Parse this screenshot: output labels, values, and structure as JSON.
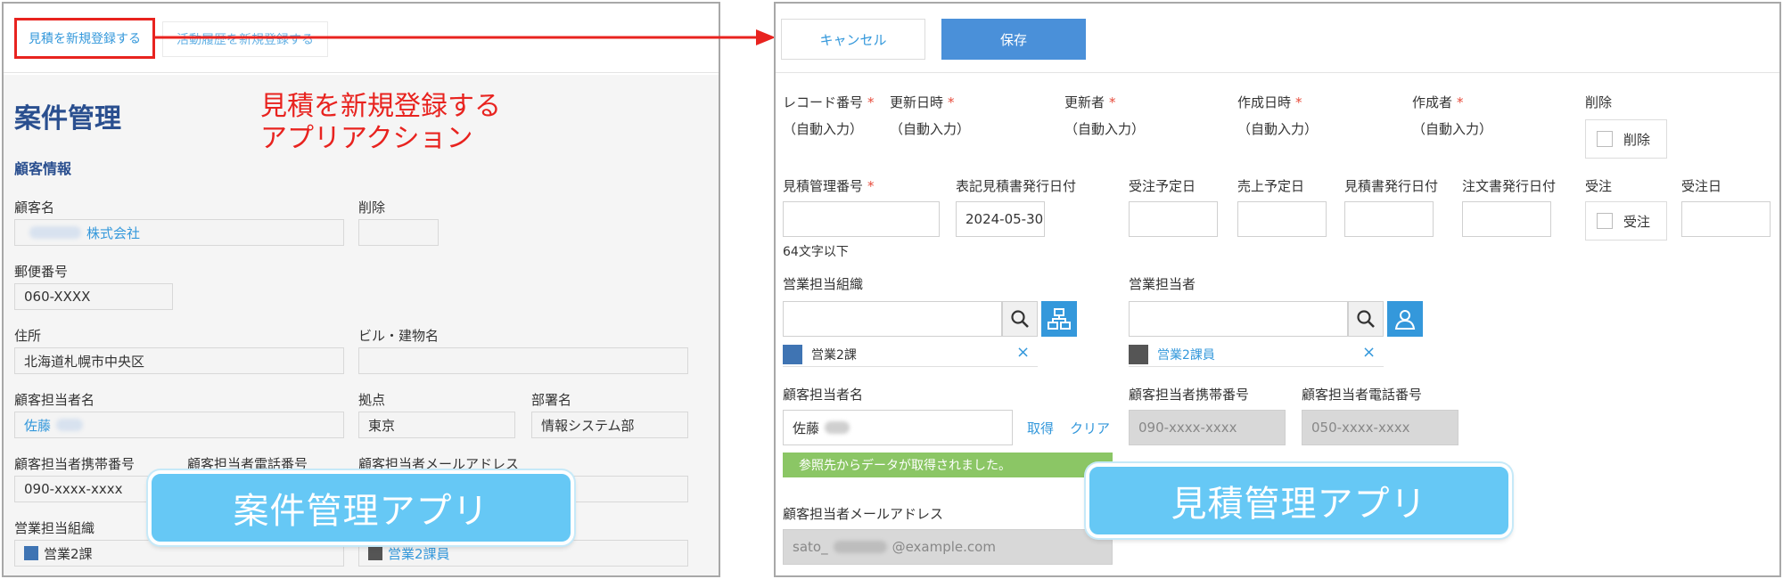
{
  "left": {
    "tabs": {
      "primary": "見積を新規登録する",
      "secondary": "活動履歴を新規登録する"
    },
    "annotation": {
      "line1": "見積を新規登録する",
      "line2": "アプリアクション"
    },
    "title": "案件管理",
    "section": "顧客情報",
    "fields": {
      "customer_name": {
        "label": "顧客名",
        "value": "株式会社"
      },
      "delete": {
        "label": "削除"
      },
      "postal": {
        "label": "郵便番号",
        "value": "060-XXXX"
      },
      "address": {
        "label": "住所",
        "value": "北海道札幌市中央区"
      },
      "building": {
        "label": "ビル・建物名"
      },
      "contact_name": {
        "label": "顧客担当者名",
        "value": "佐藤"
      },
      "branch": {
        "label": "拠点",
        "value": "東京"
      },
      "department": {
        "label": "部署名",
        "value": "情報システム部"
      },
      "contact_mobile": {
        "label": "顧客担当者携帯番号",
        "value": "090-xxxx-xxxx"
      },
      "contact_phone": {
        "label": "顧客担当者電話番号"
      },
      "contact_email": {
        "label": "顧客担当者メールアドレス"
      },
      "sales_org": {
        "label": "営業担当組織",
        "value": "営業2課"
      },
      "sales_person": {
        "value": "営業2課員"
      }
    },
    "app_badge": "案件管理アプリ"
  },
  "right": {
    "buttons": {
      "cancel": "キャンセル",
      "save": "保存"
    },
    "row1": {
      "record_no": {
        "label": "レコード番号",
        "value": "（自動入力）"
      },
      "updated_at": {
        "label": "更新日時",
        "value": "（自動入力）"
      },
      "updated_by": {
        "label": "更新者",
        "value": "（自動入力）"
      },
      "created_at": {
        "label": "作成日時",
        "value": "（自動入力）"
      },
      "created_by": {
        "label": "作成者",
        "value": "（自動入力）"
      },
      "delete": {
        "label": "削除",
        "option": "削除"
      }
    },
    "row2": {
      "estimate_no": {
        "label": "見積管理番号",
        "hint": "64文字以下"
      },
      "issue_date_display": {
        "label": "表記見積書発行日付",
        "value": "2024-05-30"
      },
      "order_plan": {
        "label": "受注予定日"
      },
      "sales_plan": {
        "label": "売上予定日"
      },
      "estimate_issue": {
        "label": "見積書発行日付"
      },
      "order_doc_issue": {
        "label": "注文書発行日付"
      },
      "order": {
        "label": "受注",
        "option": "受注"
      },
      "order_date": {
        "label": "受注日"
      }
    },
    "row3": {
      "sales_org": {
        "label": "営業担当組織",
        "value": "営業2課"
      },
      "sales_person": {
        "label": "営業担当者",
        "value": "営業2課員"
      }
    },
    "row4": {
      "contact_name": {
        "label": "顧客担当者名",
        "value": "佐藤",
        "fetch": "取得",
        "clear": "クリア"
      },
      "notice": "参照先からデータが取得されました。",
      "contact_mobile": {
        "label": "顧客担当者携帯番号",
        "value": "090-xxxx-xxxx"
      },
      "contact_phone": {
        "label": "顧客担当者電話番号",
        "value": "050-xxxx-xxxx"
      }
    },
    "row5": {
      "contact_email": {
        "label": "顧客担当者メールアドレス",
        "prefix": "sato_",
        "suffix": "@example.com"
      }
    },
    "app_badge": "見積管理アプリ"
  },
  "colors": {
    "accent_red": "#e8231f",
    "save_blue": "#4a90d9",
    "badge_blue": "#66c8f5",
    "link_blue": "#3498db",
    "notice_green": "#8bc665"
  }
}
